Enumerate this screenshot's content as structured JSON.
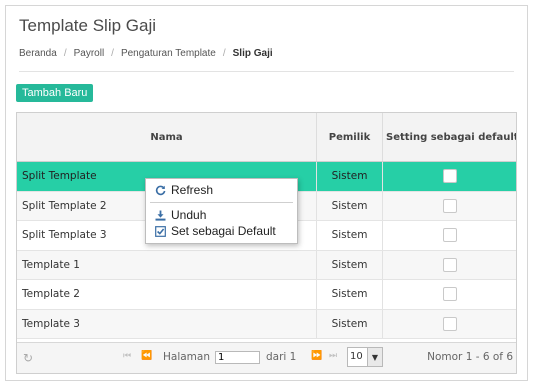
{
  "page": {
    "title": "Template Slip Gaji",
    "breadcrumb": [
      "Beranda",
      "Payroll",
      "Pengaturan Template",
      "Slip Gaji"
    ]
  },
  "toolbar": {
    "add_label": "Tambah Baru"
  },
  "grid": {
    "columns": {
      "name": "Nama",
      "owner": "Pemilik",
      "default": "Setting sebagai default"
    },
    "rows": [
      {
        "name": "Split Template",
        "owner": "Sistem",
        "default": false,
        "selected": true
      },
      {
        "name": "Split Template 2",
        "owner": "Sistem",
        "default": false
      },
      {
        "name": "Split Template 3",
        "owner": "Sistem",
        "default": false
      },
      {
        "name": "Template 1",
        "owner": "Sistem",
        "default": false
      },
      {
        "name": "Template 2",
        "owner": "Sistem",
        "default": false
      },
      {
        "name": "Template 3",
        "owner": "Sistem",
        "default": false
      }
    ]
  },
  "pager": {
    "page_label": "Halaman",
    "page_value": "1",
    "of_label": "dari 1",
    "page_size": "10",
    "info": "Nomor 1 - 6 of 6"
  },
  "context_menu": {
    "refresh": "Refresh",
    "download": "Unduh",
    "set_default": "Set sebagai Default"
  },
  "colors": {
    "accent": "#26b99a",
    "selected_row": "#26cfa6"
  },
  "icons": [
    "refresh-icon",
    "download-icon",
    "checkbox-checked-icon",
    "first-page-icon",
    "prev-page-icon",
    "next-page-icon",
    "last-page-icon",
    "chevron-down-icon"
  ]
}
